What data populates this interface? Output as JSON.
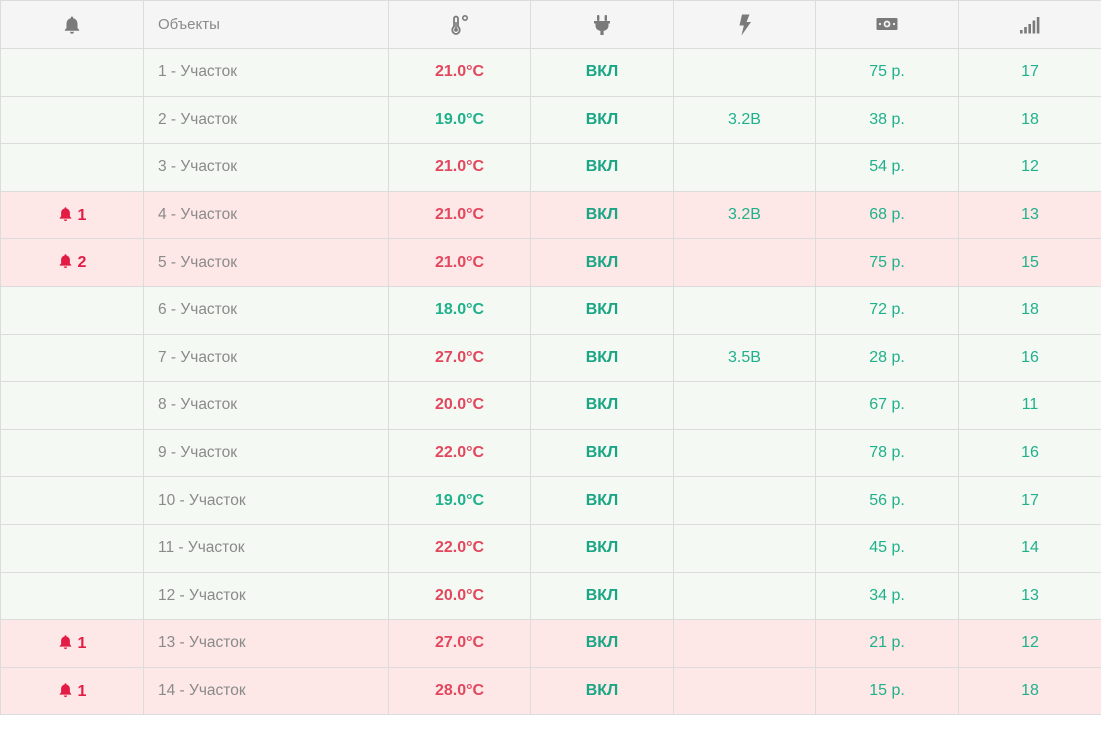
{
  "colors": {
    "accent_red": "#e2475e",
    "accent_green": "#1fb08c",
    "alarm_icon": "#e31c46",
    "row_ok_bg": "#f4f9f3",
    "row_alarm_bg": "#fde7e7"
  },
  "header": {
    "alarms_icon": "bell-icon",
    "objects_label": "Объекты",
    "temperature_icon": "thermometer-icon",
    "power_icon": "plug-icon",
    "voltage_icon": "lightning-icon",
    "balance_icon": "money-icon",
    "signal_icon": "signal-bars-icon"
  },
  "rows": [
    {
      "alarm": "",
      "name": "1 - Участок",
      "temp": "21.0°C",
      "temp_color": "red",
      "power": "ВКЛ",
      "voltage": "",
      "balance": "75 р.",
      "signal": "17",
      "state": "ok"
    },
    {
      "alarm": "",
      "name": "2 - Участок",
      "temp": "19.0°C",
      "temp_color": "green",
      "power": "ВКЛ",
      "voltage": "3.2В",
      "balance": "38 р.",
      "signal": "18",
      "state": "ok"
    },
    {
      "alarm": "",
      "name": "3 - Участок",
      "temp": "21.0°C",
      "temp_color": "red",
      "power": "ВКЛ",
      "voltage": "",
      "balance": "54 р.",
      "signal": "12",
      "state": "ok"
    },
    {
      "alarm": "1",
      "name": "4 - Участок",
      "temp": "21.0°C",
      "temp_color": "red",
      "power": "ВКЛ",
      "voltage": "3.2В",
      "balance": "68 р.",
      "signal": "13",
      "state": "alarm"
    },
    {
      "alarm": "2",
      "name": "5 - Участок",
      "temp": "21.0°C",
      "temp_color": "red",
      "power": "ВКЛ",
      "voltage": "",
      "balance": "75 р.",
      "signal": "15",
      "state": "alarm"
    },
    {
      "alarm": "",
      "name": "6 - Участок",
      "temp": "18.0°C",
      "temp_color": "green",
      "power": "ВКЛ",
      "voltage": "",
      "balance": "72 р.",
      "signal": "18",
      "state": "ok"
    },
    {
      "alarm": "",
      "name": "7 - Участок",
      "temp": "27.0°C",
      "temp_color": "red",
      "power": "ВКЛ",
      "voltage": "3.5В",
      "balance": "28 р.",
      "signal": "16",
      "state": "ok"
    },
    {
      "alarm": "",
      "name": "8 - Участок",
      "temp": "20.0°C",
      "temp_color": "red",
      "power": "ВКЛ",
      "voltage": "",
      "balance": "67 р.",
      "signal": "11",
      "state": "ok"
    },
    {
      "alarm": "",
      "name": "9 - Участок",
      "temp": "22.0°C",
      "temp_color": "red",
      "power": "ВКЛ",
      "voltage": "",
      "balance": "78 р.",
      "signal": "16",
      "state": "ok"
    },
    {
      "alarm": "",
      "name": "10 - Участок",
      "temp": "19.0°C",
      "temp_color": "green",
      "power": "ВКЛ",
      "voltage": "",
      "balance": "56 р.",
      "signal": "17",
      "state": "ok"
    },
    {
      "alarm": "",
      "name": "11 - Участок",
      "temp": "22.0°C",
      "temp_color": "red",
      "power": "ВКЛ",
      "voltage": "",
      "balance": "45 р.",
      "signal": "14",
      "state": "ok"
    },
    {
      "alarm": "",
      "name": "12 - Участок",
      "temp": "20.0°C",
      "temp_color": "red",
      "power": "ВКЛ",
      "voltage": "",
      "balance": "34 р.",
      "signal": "13",
      "state": "ok"
    },
    {
      "alarm": "1",
      "name": "13 - Участок",
      "temp": "27.0°C",
      "temp_color": "red",
      "power": "ВКЛ",
      "voltage": "",
      "balance": "21 р.",
      "signal": "12",
      "state": "alarm"
    },
    {
      "alarm": "1",
      "name": "14 - Участок",
      "temp": "28.0°C",
      "temp_color": "red",
      "power": "ВКЛ",
      "voltage": "",
      "balance": "15 р.",
      "signal": "18",
      "state": "alarm"
    }
  ]
}
